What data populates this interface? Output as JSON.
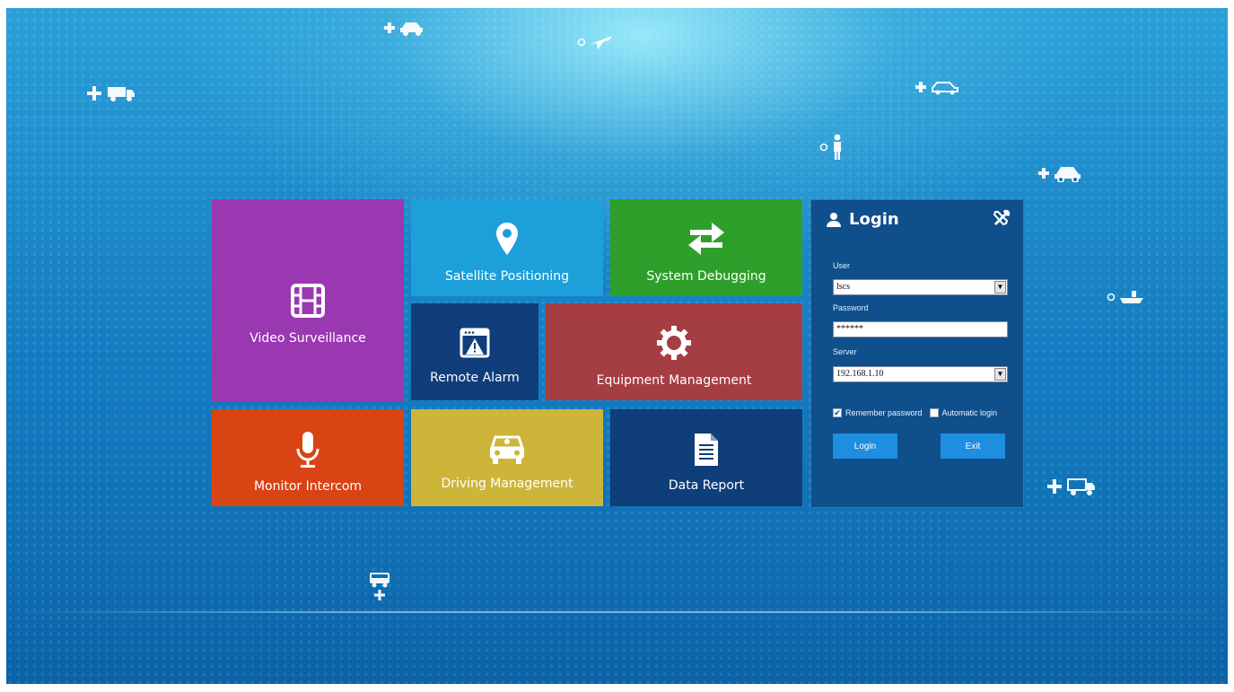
{
  "colors": {
    "video": "#9a38b2",
    "satellite": "#1d9fd9",
    "debug": "#2e9f2b",
    "alarm": "#0f3e7a",
    "equipment": "#a53e43",
    "intercom": "#d94414",
    "driving": "#cdb53a",
    "report": "#0f3e7a",
    "login_bg": "#0f4f8c",
    "button": "#1d8ee0"
  },
  "tiles": {
    "video": {
      "label": "Video Surveillance",
      "icon": "film-icon"
    },
    "satellite": {
      "label": "Satellite Positioning",
      "icon": "map-pin-icon"
    },
    "debug": {
      "label": "System Debugging",
      "icon": "swap-arrows-icon"
    },
    "alarm": {
      "label": "Remote Alarm",
      "icon": "alarm-window-icon"
    },
    "equipment": {
      "label": "Equipment Management",
      "icon": "gear-icon"
    },
    "intercom": {
      "label": "Monitor Intercom",
      "icon": "microphone-icon"
    },
    "driving": {
      "label": "Driving Management",
      "icon": "car-icon"
    },
    "report": {
      "label": "Data Report",
      "icon": "document-icon"
    }
  },
  "login": {
    "title": "Login",
    "user_label": "User",
    "user_value": "lscs",
    "password_label": "Password",
    "password_value": "******",
    "server_label": "Server",
    "server_value": "192.168.1.10",
    "remember_label": "Remember password",
    "remember_checked": true,
    "auto_label": "Automatic login",
    "auto_checked": false,
    "login_button": "Login",
    "exit_button": "Exit"
  },
  "decorations": [
    "plus-truck-icon",
    "plus-car-icon",
    "plane-icon",
    "plus-car-icon",
    "person-icon",
    "plus-car-icon",
    "ship-icon",
    "plus-truck-icon",
    "bus-icon"
  ]
}
